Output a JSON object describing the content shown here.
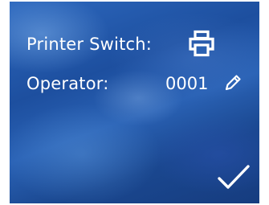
{
  "settings": {
    "printer_switch_label": "Printer Switch:",
    "operator_label": "Operator:",
    "operator_value": "0001"
  },
  "icons": {
    "printer": "printer-icon",
    "edit": "pencil-icon",
    "confirm": "checkmark-icon"
  },
  "colors": {
    "text": "#ffffff",
    "background_primary": "#2358a8"
  }
}
